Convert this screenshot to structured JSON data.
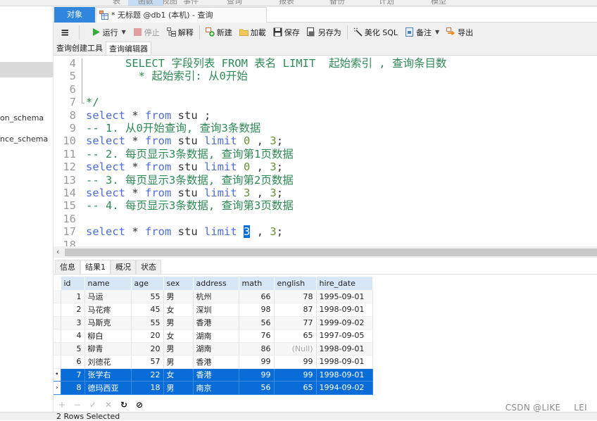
{
  "menubar": {
    "items": [
      "表",
      "视图",
      "函数",
      "事件",
      "查询",
      "报表",
      "备份",
      "计划",
      "模型"
    ],
    "active_index": 2
  },
  "sidebar": {
    "items": [
      {
        "label": "on_schema"
      },
      {
        "label": "nce_schema"
      }
    ]
  },
  "tabs": {
    "objects_label": "对象",
    "query_tab_label": "* 无标题 @db1 (本机) - 查询"
  },
  "toolbar": {
    "menu_icon": "hamburger-icon",
    "run_label": "运行",
    "stop_label": "停止",
    "explain_label": "解释",
    "new_label": "新建",
    "load_label": "加載",
    "save_label": "保存",
    "save_as_label": "另存为",
    "beautify_label": "美化 SQL",
    "comment_label": "备注",
    "export_label": "导出"
  },
  "subtabs": {
    "builder_label": "查询创建工具",
    "editor_label": "查询编辑器"
  },
  "editor": {
    "lines": [
      {
        "n": "4",
        "parts": [
          {
            "t": "      SELECT 字段列表 FROM 表名 LIMIT  起始索引 , 查询条目数",
            "c": "cm"
          }
        ]
      },
      {
        "n": "5",
        "parts": [
          {
            "t": "        * 起始索引: 从0开始",
            "c": "cm"
          }
        ]
      },
      {
        "n": "6",
        "parts": []
      },
      {
        "n": "7",
        "parts": [
          {
            "t": "*/",
            "c": "cm"
          }
        ]
      },
      {
        "n": "8",
        "parts": [
          {
            "t": "select",
            "c": "kw"
          },
          {
            "t": " * ",
            "c": "plain"
          },
          {
            "t": "from",
            "c": "kw"
          },
          {
            "t": " stu ;",
            "c": "plain"
          }
        ]
      },
      {
        "n": "9",
        "parts": [
          {
            "t": "-- 1. 从0开始查询, 查询3条数据",
            "c": "cm"
          }
        ]
      },
      {
        "n": "10",
        "parts": [
          {
            "t": "select",
            "c": "kw"
          },
          {
            "t": " * ",
            "c": "plain"
          },
          {
            "t": "from",
            "c": "kw"
          },
          {
            "t": " stu ",
            "c": "plain"
          },
          {
            "t": "limit",
            "c": "kw"
          },
          {
            "t": " 0 ",
            "c": "num"
          },
          {
            "t": ", ",
            "c": "plain"
          },
          {
            "t": "3",
            "c": "num"
          },
          {
            "t": ";",
            "c": "plain"
          }
        ]
      },
      {
        "n": "11",
        "parts": [
          {
            "t": "-- 2. 每页显示3条数据, 查询第1页数据",
            "c": "cm"
          }
        ]
      },
      {
        "n": "12",
        "parts": [
          {
            "t": "select",
            "c": "kw"
          },
          {
            "t": " * ",
            "c": "plain"
          },
          {
            "t": "from",
            "c": "kw"
          },
          {
            "t": " stu ",
            "c": "plain"
          },
          {
            "t": "limit",
            "c": "kw"
          },
          {
            "t": " 0 ",
            "c": "num"
          },
          {
            "t": ", ",
            "c": "plain"
          },
          {
            "t": "3",
            "c": "num"
          },
          {
            "t": ";",
            "c": "plain"
          }
        ]
      },
      {
        "n": "13",
        "parts": [
          {
            "t": "-- 3. 每页显示3条数据, 查询第2页数据",
            "c": "cm"
          }
        ]
      },
      {
        "n": "14",
        "parts": [
          {
            "t": "select",
            "c": "kw"
          },
          {
            "t": " * ",
            "c": "plain"
          },
          {
            "t": "from",
            "c": "kw"
          },
          {
            "t": " stu ",
            "c": "plain"
          },
          {
            "t": "limit",
            "c": "kw"
          },
          {
            "t": " 3 ",
            "c": "num"
          },
          {
            "t": ", ",
            "c": "plain"
          },
          {
            "t": "3",
            "c": "num"
          },
          {
            "t": ";",
            "c": "plain"
          }
        ]
      },
      {
        "n": "15",
        "parts": [
          {
            "t": "-- 4. 每页显示3条数据, 查询第3页数据",
            "c": "cm"
          }
        ]
      },
      {
        "n": "16",
        "parts": []
      },
      {
        "n": "17",
        "parts": [
          {
            "t": "select",
            "c": "kw"
          },
          {
            "t": " * ",
            "c": "plain"
          },
          {
            "t": "from",
            "c": "kw"
          },
          {
            "t": " stu ",
            "c": "plain"
          },
          {
            "t": "limit",
            "c": "kw"
          },
          {
            "t": " ",
            "c": "plain"
          },
          {
            "t": "3",
            "c": "hl"
          },
          {
            "t": " , ",
            "c": "plain"
          },
          {
            "t": "3",
            "c": "num"
          },
          {
            "t": ";",
            "c": "plain"
          }
        ]
      },
      {
        "n": "18",
        "parts": []
      }
    ]
  },
  "result_tabs": [
    "信息",
    "结果1",
    "概况",
    "状态"
  ],
  "result_active": 1,
  "grid": {
    "columns": [
      "id",
      "name",
      "age",
      "sex",
      "address",
      "math",
      "english",
      "hire_date"
    ],
    "rows": [
      {
        "id": "1",
        "name": "马运",
        "age": "55",
        "sex": "男",
        "address": "杭州",
        "math": "66",
        "english": "78",
        "hire_date": "1995-09-01",
        "selected": false,
        "marker": ""
      },
      {
        "id": "2",
        "name": "马花疼",
        "age": "45",
        "sex": "女",
        "address": "深圳",
        "math": "98",
        "english": "87",
        "hire_date": "1998-09-01",
        "selected": false,
        "marker": ""
      },
      {
        "id": "3",
        "name": "马斯克",
        "age": "55",
        "sex": "男",
        "address": "香港",
        "math": "56",
        "english": "77",
        "hire_date": "1999-09-02",
        "selected": false,
        "marker": ""
      },
      {
        "id": "4",
        "name": "柳白",
        "age": "20",
        "sex": "女",
        "address": "湖南",
        "math": "76",
        "english": "65",
        "hire_date": "1997-09-05",
        "selected": false,
        "marker": ""
      },
      {
        "id": "5",
        "name": "柳青",
        "age": "20",
        "sex": "男",
        "address": "湖南",
        "math": "86",
        "english": "(Null)",
        "hire_date": "1998-09-01",
        "selected": false,
        "marker": ""
      },
      {
        "id": "6",
        "name": "刘德花",
        "age": "57",
        "sex": "男",
        "address": "香港",
        "math": "99",
        "english": "99",
        "hire_date": "1998-09-01",
        "selected": false,
        "marker": ""
      },
      {
        "id": "7",
        "name": "张学右",
        "age": "22",
        "sex": "女",
        "address": "香港",
        "math": "99",
        "english": "99",
        "hire_date": "1998-09-01",
        "selected": true,
        "marker": "•"
      },
      {
        "id": "8",
        "name": "德玛西亚",
        "age": "18",
        "sex": "男",
        "address": "南京",
        "math": "56",
        "english": "65",
        "hire_date": "1994-09-02",
        "selected": true,
        "marker": "›"
      }
    ]
  },
  "actions": {
    "add": "+",
    "delete": "−",
    "apply": "✓",
    "discard": "✕",
    "refresh": "↻",
    "stop": "⊘"
  },
  "status": {
    "text": "2 Rows Selected"
  },
  "watermark": "CSDN @LIKE___LEI",
  "colors": {
    "accent": "#0a6cd6",
    "objects_tab": "#2f86dc",
    "keyword": "#4d6ed6",
    "comment": "#2f8a55"
  }
}
